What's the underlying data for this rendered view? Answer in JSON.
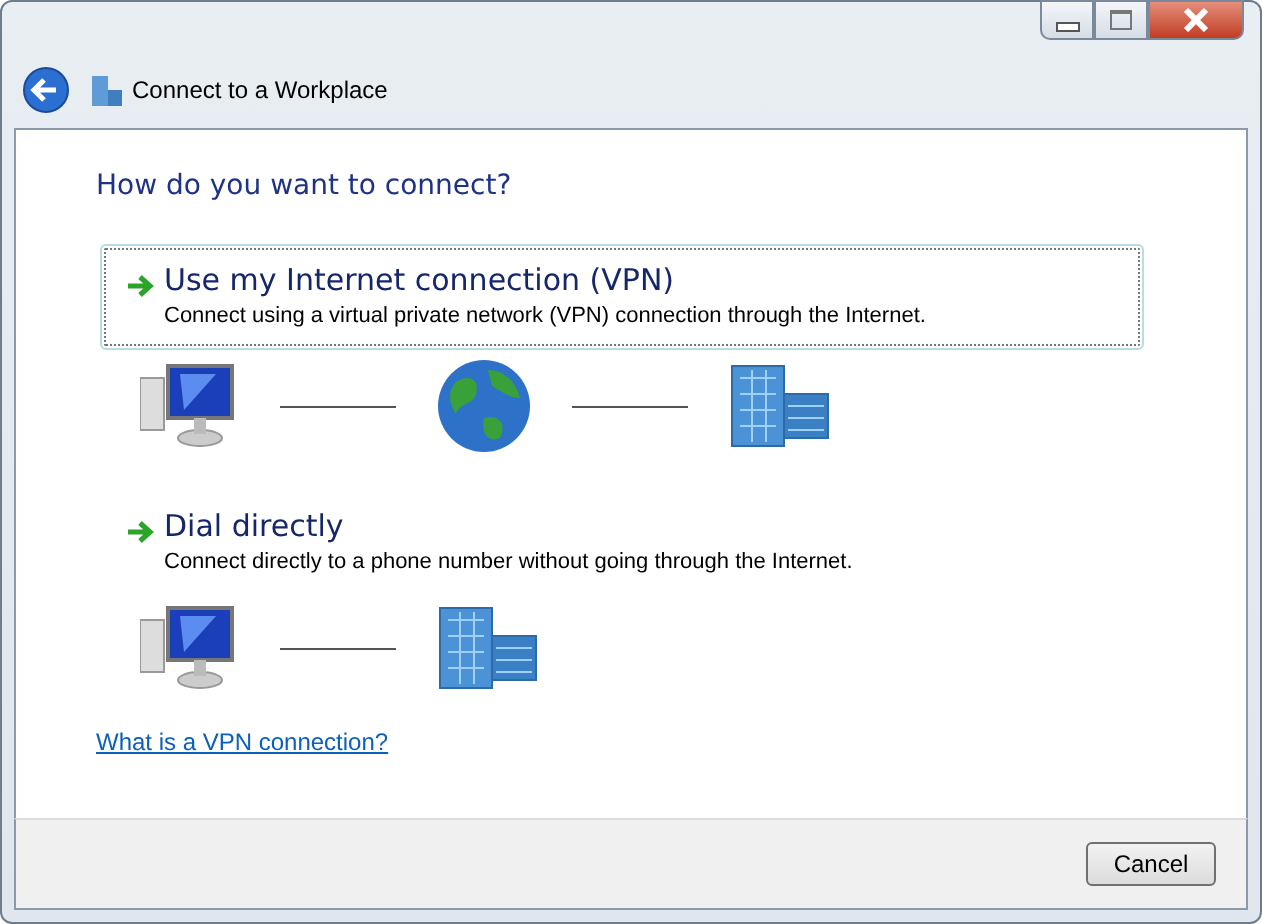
{
  "window": {
    "title": "Connect to a Workplace"
  },
  "heading": "How do you want to connect?",
  "options": [
    {
      "title": "Use my Internet connection (VPN)",
      "description": "Connect using a virtual private network (VPN) connection through the Internet.",
      "selected": true,
      "diagram": [
        {
          "kind": "computer"
        },
        {
          "kind": "globe"
        },
        {
          "kind": "building"
        }
      ]
    },
    {
      "title": "Dial directly",
      "description": "Connect directly to a phone number without going through the Internet.",
      "selected": false,
      "diagram": [
        {
          "kind": "computer"
        },
        {
          "kind": "building"
        }
      ]
    }
  ],
  "help_link": "What is a VPN connection?",
  "buttons": [
    {
      "label": "Cancel"
    }
  ]
}
